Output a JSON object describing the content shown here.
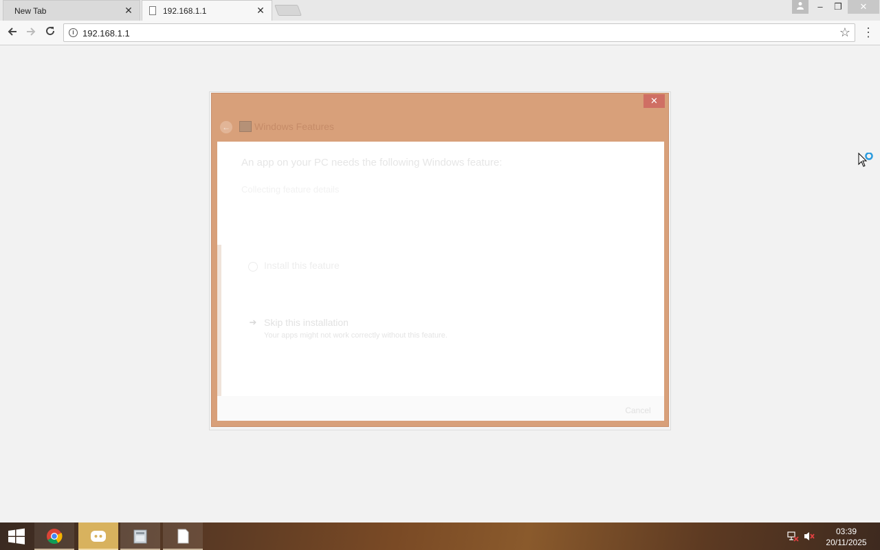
{
  "browser": {
    "tabs": [
      {
        "label": "New Tab",
        "active": false
      },
      {
        "label": "192.168.1.1",
        "active": true
      }
    ],
    "address_bar": {
      "url": "192.168.1.1"
    }
  },
  "dialog": {
    "title": "Windows Features",
    "heading": "An app on your PC needs the following Windows feature:",
    "status": "Collecting feature details",
    "option_install": {
      "label": "Install this feature"
    },
    "option_skip": {
      "label": "Skip this installation",
      "sublabel": "Your apps might not work correctly without this feature."
    },
    "cancel_label": "Cancel",
    "close_glyph": "✕",
    "accent_color": "#d8a07a"
  },
  "taskbar": {
    "apps": [
      {
        "name": "Google Chrome",
        "icon": "chrome-icon"
      },
      {
        "name": "Discord",
        "icon": "discord-icon",
        "active": true
      },
      {
        "name": "File Explorer",
        "icon": "explorer-icon"
      },
      {
        "name": "Notepad",
        "icon": "notepad-icon"
      }
    ],
    "clock": {
      "time": "03:39",
      "date": "20/11/2025"
    }
  }
}
